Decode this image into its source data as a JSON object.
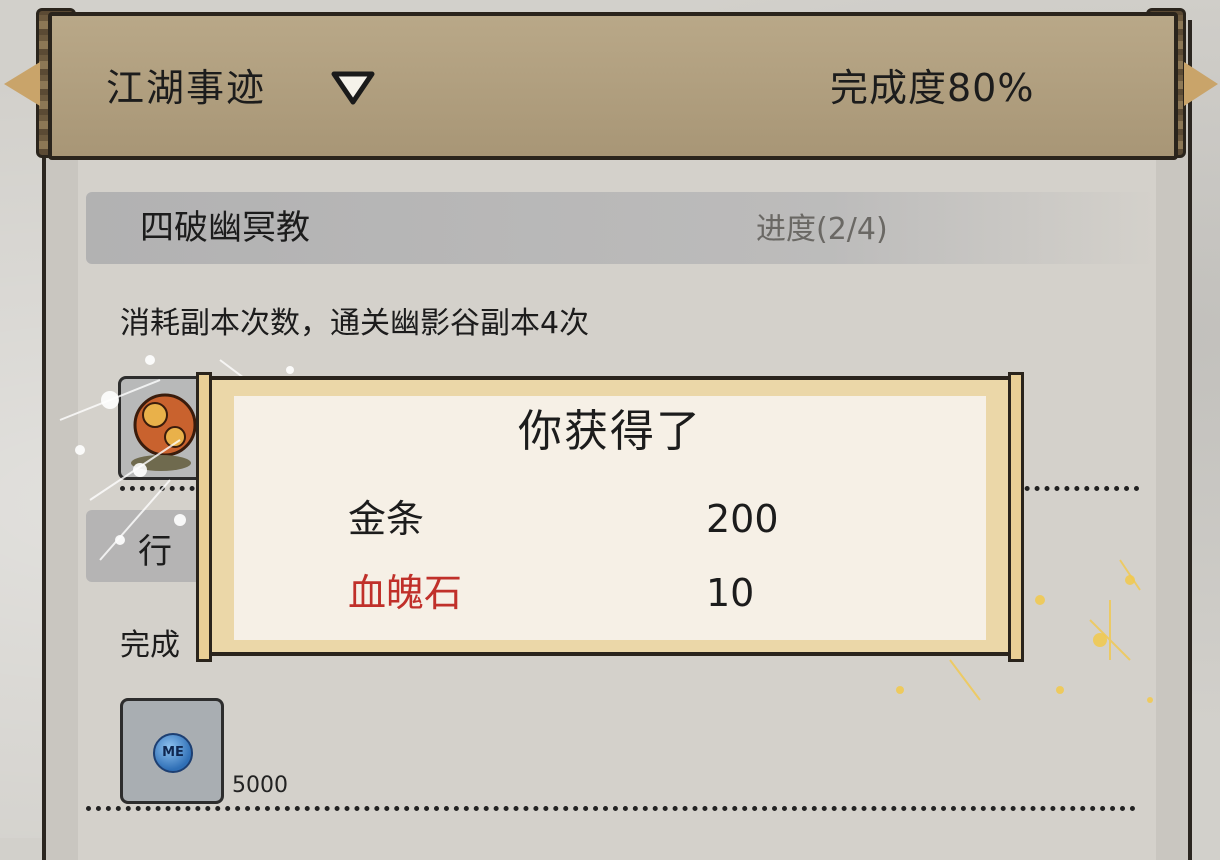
{
  "header": {
    "title": "江湖事迹",
    "completion": "完成度80%"
  },
  "quest": {
    "name": "四破幽冥教",
    "progress": "进度(2/4)",
    "description": "消耗副本次数，通关幽影谷副本4次"
  },
  "task": {
    "name_partial": "行",
    "desc_partial": "完成",
    "reward_quantity": "5000",
    "coin_label": "ME"
  },
  "reward_dialog": {
    "title": "你获得了",
    "items": [
      {
        "name": "金条",
        "amount": "200",
        "color": "#1c1c1c"
      },
      {
        "name": "血魄石",
        "amount": "10",
        "color": "#c0302a"
      }
    ]
  },
  "colors": {
    "header_bg": "#b0a080",
    "panel_bg": "#d4d1cb",
    "dialog_frame": "#ebd7a8",
    "dialog_sheet": "#f6f0e6",
    "rare_item": "#c0302a",
    "sparkle": "#f2c94c"
  }
}
